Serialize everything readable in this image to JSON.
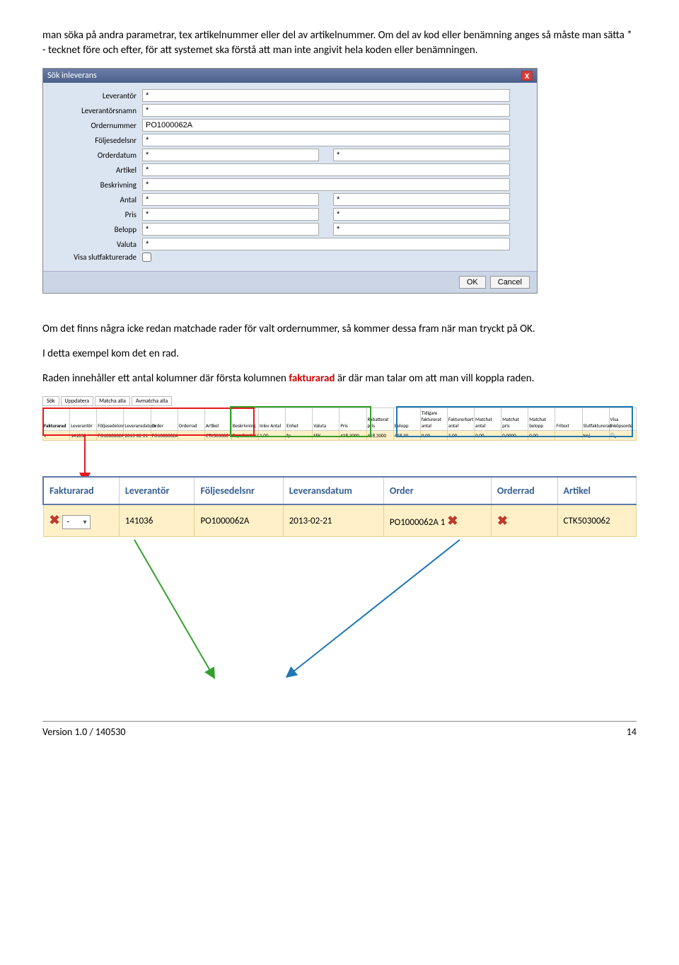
{
  "para1": "man söka på andra parametrar, tex artikelnummer eller del av artikelnummer. Om del av kod eller benämning anges så måste man sätta * - tecknet före och efter, för att systemet ska förstå att man inte angivit hela koden eller benämningen.",
  "dialog": {
    "title": "Sök inleverans",
    "fields": {
      "leverantor": {
        "label": "Leverantör",
        "value": "*"
      },
      "leverantorsnamn": {
        "label": "Leverantörsnamn",
        "value": "*"
      },
      "ordernummer": {
        "label": "Ordernummer",
        "value": "PO1000062A"
      },
      "foljesedelsnr": {
        "label": "Följesedelsnr",
        "value": "*"
      },
      "orderdatum": {
        "label": "Orderdatum",
        "value1": "*",
        "value2": "*"
      },
      "artikel": {
        "label": "Artikel",
        "value": "*"
      },
      "beskrivning": {
        "label": "Beskrivning",
        "value": "*"
      },
      "antal": {
        "label": "Antal",
        "value1": "*",
        "value2": "*"
      },
      "pris": {
        "label": "Pris",
        "value1": "*",
        "value2": "*"
      },
      "belopp": {
        "label": "Belopp",
        "value1": "*",
        "value2": "*"
      },
      "valuta": {
        "label": "Valuta",
        "value": "*"
      },
      "visa_slutfakturerade": {
        "label": "Visa slutfakturerade"
      }
    },
    "ok": "OK",
    "cancel": "Cancel"
  },
  "para2": "Om det finns några icke redan matchade rader för valt ordernummer, så kommer dessa fram när man tryckt på OK.",
  "para3": "I detta exempel kom det en rad.",
  "para4_a": "Raden innehåller ett antal kolumner där första kolumnen ",
  "para4_kw": "fakturarad",
  "para4_b": " är där man talar om att man vill koppla raden.",
  "toolbar": [
    "Sök",
    "Uppdatera",
    "Matcha alla",
    "Avmatcha alla"
  ],
  "grid": {
    "headers": [
      "Fakturarad",
      "Leverantör",
      "Följesedelsnr",
      "Leveransdatum",
      "Order",
      "Orderrad",
      "Artikel",
      "Beskrivning",
      "Inlev Antal",
      "Enhet",
      "Valuta",
      "Pris",
      "Rabatterat pris",
      "Belopp",
      "Tidigare fakturerat antal",
      "Fakturerbart antal",
      "Matchat antal",
      "Matchat pris",
      "Matchat belopp",
      "Fritext",
      "Slutfakturerad",
      "Visa Inköpsorde"
    ],
    "row": [
      "▾",
      "141036",
      "PO1000062A",
      "2013-02-21",
      "PO1000062A 1",
      "",
      "CTK503006",
      "Expellus 20Ul, pre-sterile w/ filter, hinged rac",
      "1,00",
      "fp",
      "SEK",
      "418,3000",
      "418,3000",
      "418,30",
      "0,00",
      "1,00",
      "0,00",
      "0,0000",
      "0,00",
      "",
      "Nej",
      "🔍"
    ]
  },
  "zoom": {
    "headers": [
      "Fakturarad",
      "Leverantör",
      "Följesedelsnr",
      "Leveransdatum",
      "Order",
      "Orderrad",
      "Artikel"
    ],
    "row": [
      "-",
      "141036",
      "PO1000062A",
      "2013-02-21",
      "PO1000062A 1",
      "",
      "CTK5030062"
    ]
  },
  "footer": {
    "left": "Version 1.0  /  140530",
    "right": "14"
  }
}
